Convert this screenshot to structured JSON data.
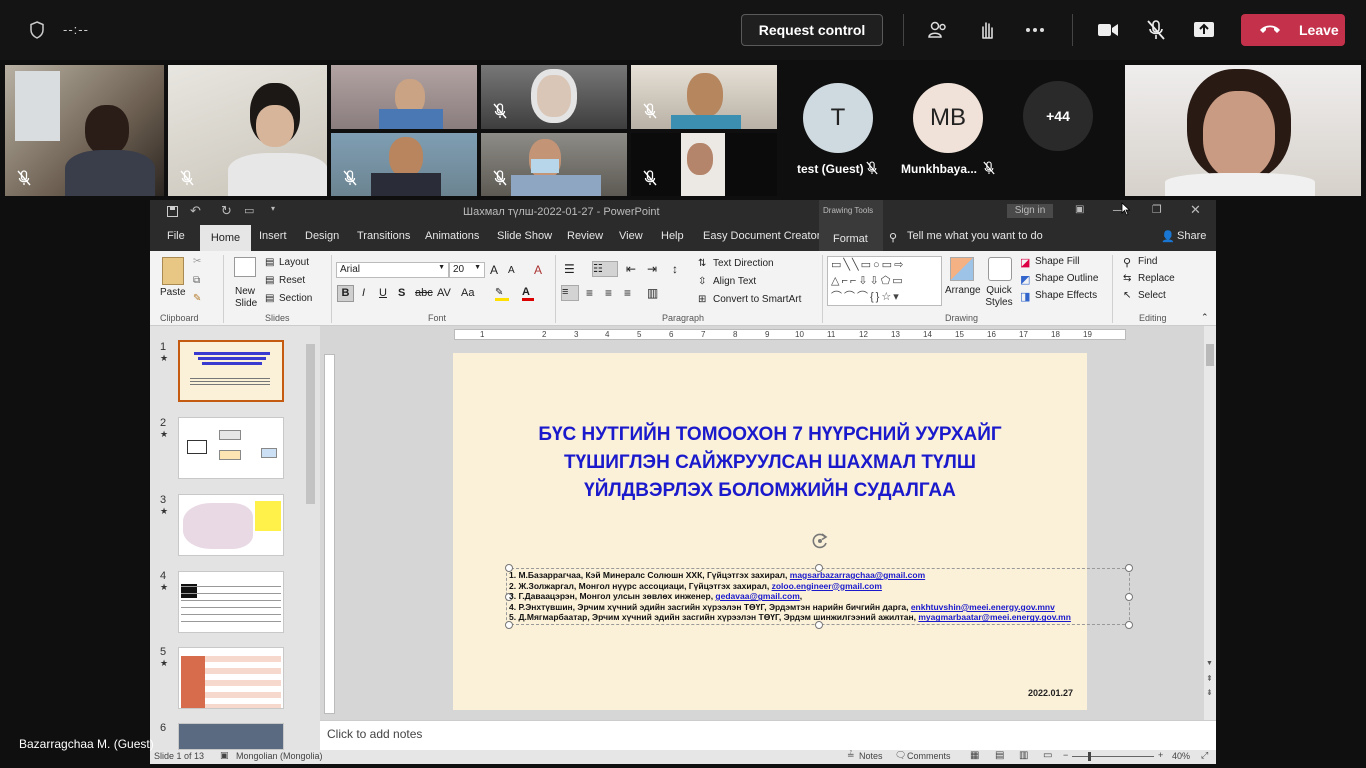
{
  "teams": {
    "timer": "--:--",
    "request_control": "Request control",
    "leave": "Leave",
    "self_name": "Bazarragchaa M. (Guest)",
    "avatars": [
      {
        "initials": "T",
        "name": "test (Guest)"
      },
      {
        "initials": "MB",
        "name": "Munkhbaya..."
      },
      {
        "initials": "+44",
        "name": ""
      }
    ]
  },
  "ppt": {
    "window_title": "Шахмал түлш-2022-01-27  -  PowerPoint",
    "drawing_tools": "Drawing Tools",
    "sign_in": "Sign in",
    "tabs": [
      "File",
      "Home",
      "Insert",
      "Design",
      "Transitions",
      "Animations",
      "Slide Show",
      "Review",
      "View",
      "Help",
      "Easy Document Creator",
      "Format"
    ],
    "tell_me": "Tell me what you want to do",
    "share": "Share",
    "ribbon": {
      "paste": "Paste",
      "new_slide": "New Slide",
      "layout": "Layout",
      "reset": "Reset",
      "section": "Section",
      "font_name": "Arial",
      "font_size": "20",
      "text_direction": "Text Direction",
      "align_text": "Align Text",
      "convert_smartart": "Convert to SmartArt",
      "arrange": "Arrange",
      "quick_styles": "Quick Styles",
      "shape_fill": "Shape Fill",
      "shape_outline": "Shape Outline",
      "shape_effects": "Shape Effects",
      "find": "Find",
      "replace": "Replace",
      "select": "Select",
      "groups": [
        "Clipboard",
        "Slides",
        "Font",
        "Paragraph",
        "Drawing",
        "Editing"
      ]
    },
    "thumb_numbers": [
      "1",
      "2",
      "3",
      "4",
      "5",
      "6"
    ],
    "ruler_numbers": [
      "1",
      "2",
      "3",
      "4",
      "5",
      "6",
      "7",
      "8",
      "9",
      "10",
      "11",
      "12",
      "13",
      "14",
      "15",
      "16",
      "17",
      "18",
      "19"
    ],
    "slide": {
      "title_lines": [
        "БҮС НУТГИЙН ТОМООХОН 7 НҮҮРСНИЙ УУРХАЙГ",
        "ТҮШИГЛЭН САЙЖРУУЛСАН ШАХМАЛ ТҮЛШ",
        "ҮЙЛДВЭРЛЭХ БОЛОМЖИЙН СУДАЛГАА"
      ],
      "authors": [
        {
          "text": "1.  М.Базаррагчаа, Кэй Минералс Солюшн ХХК, Гүйцэтгэх захирал, ",
          "email": "magsarbazarragchaa@gmail.com"
        },
        {
          "text": "2.  Ж.Золжаргал, Монгол нүүрс ассоциаци, Гүйцэтгэх захирал, ",
          "email": "zoloo.engineer@gmail.com"
        },
        {
          "text": "3.  Г.Даваацэрэн, Монгол улсын зөвлөх инженер, ",
          "email": "gedavaa@gmail.com"
        },
        {
          "text": "4.  Р.Энхтүвшин, Эрчим хүчний эдийн засгийн хүрээлэн ТӨҮГ, Эрдэмтэн нарийн бичгийн дарга, ",
          "email": "enkhtuvshin@meei.energy.gov.mnv"
        },
        {
          "text": "5.  Д.Мягмарбаатар, Эрчим хүчний эдийн засгийн хүрээлэн ТӨҮГ,  Эрдэм шинжилгээний ажилтан, ",
          "email": "myagmarbaatar@meei.energy.gov.mn"
        }
      ],
      "date": "2022.01.27"
    },
    "notes_placeholder": "Click to add notes",
    "status": {
      "slide_of": "Slide 1 of 13",
      "language": "Mongolian (Mongolia)",
      "notes": "Notes",
      "comments": "Comments",
      "zoom": "40%"
    }
  }
}
